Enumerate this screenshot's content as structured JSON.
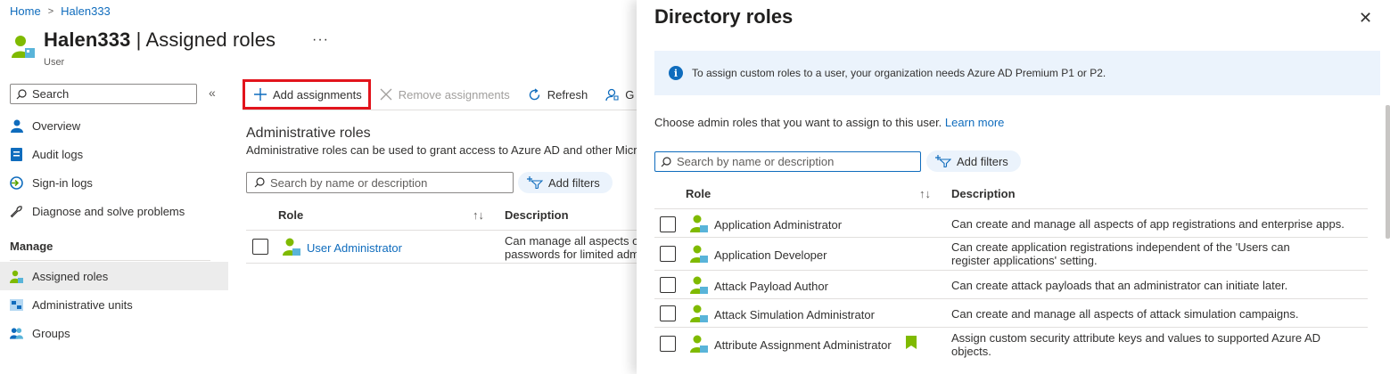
{
  "breadcrumb": {
    "home": "Home",
    "current": "Halen333"
  },
  "header": {
    "title_name": "Halen333",
    "title_rest": " | Assigned roles",
    "subtitle": "User",
    "more": "···"
  },
  "left_nav": {
    "search_placeholder": "Search",
    "collapse": "«",
    "items": [
      {
        "label": "Overview",
        "icon": "user-icon"
      },
      {
        "label": "Audit logs",
        "icon": "audit-log-icon"
      },
      {
        "label": "Sign-in logs",
        "icon": "sign-in-icon"
      },
      {
        "label": "Diagnose and solve problems",
        "icon": "wrench-icon"
      }
    ],
    "section_heading": "Manage",
    "manage_items": [
      {
        "label": "Assigned roles",
        "icon": "assigned-roles-icon",
        "active": true
      },
      {
        "label": "Administrative units",
        "icon": "admin-units-icon"
      },
      {
        "label": "Groups",
        "icon": "groups-icon"
      }
    ]
  },
  "toolbar": {
    "add": "Add assignments",
    "remove": "Remove assignments",
    "refresh": "Refresh",
    "cutoff": "G"
  },
  "main": {
    "section_title": "Administrative roles",
    "section_desc": "Administrative roles can be used to grant access to Azure AD and other Microsoft services.",
    "search_placeholder": "Search by name or description",
    "add_filters": "Add filters",
    "col_role": "Role",
    "col_desc": "Description",
    "rows": [
      {
        "role": "User Administrator",
        "desc_line1": "Can manage all aspects of",
        "desc_line2": "passwords for limited adm"
      }
    ]
  },
  "panel": {
    "title": "Directory roles",
    "close": "✕",
    "info": "To assign custom roles to a user, your organization needs Azure AD Premium P1 or P2.",
    "choose_text": "Choose admin roles that you want to assign to this user.",
    "learn_more": "Learn more",
    "search_placeholder": "Search by name or description",
    "add_filters": "Add filters",
    "col_role": "Role",
    "col_desc": "Description",
    "rows": [
      {
        "role": "Application Administrator",
        "desc": "Can create and manage all aspects of app registrations and enterprise apps."
      },
      {
        "role": "Application Developer",
        "desc": "Can create application registrations independent of the 'Users can register applications' setting."
      },
      {
        "role": "Attack Payload Author",
        "desc": "Can create attack payloads that an administrator can initiate later."
      },
      {
        "role": "Attack Simulation Administrator",
        "desc": "Can create and manage all aspects of attack simulation campaigns."
      },
      {
        "role": "Attribute Assignment Administrator",
        "desc": "Assign custom security attribute keys and values to supported Azure AD objects.",
        "bookmark": true
      }
    ]
  },
  "colors": {
    "accent": "#0f6cbd",
    "highlight": "#e2141c",
    "role_icon_green": "#7fba00"
  }
}
